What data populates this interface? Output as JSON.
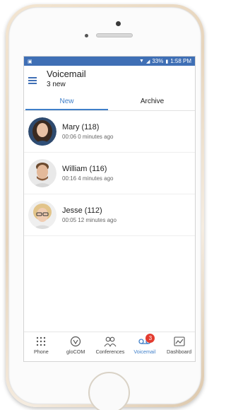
{
  "status_bar": {
    "battery": "33%",
    "time": "1:58 PM"
  },
  "header": {
    "title": "Voicemail",
    "subtitle": "3 new"
  },
  "tabs": [
    {
      "label": "New",
      "active": true
    },
    {
      "label": "Archive",
      "active": false
    }
  ],
  "voicemails": [
    {
      "name": "Mary (118)",
      "meta": "00:06 0 minutes ago"
    },
    {
      "name": "William (116)",
      "meta": "00:16 4 minutes ago"
    },
    {
      "name": "Jesse (112)",
      "meta": "00:05 12 minutes ago"
    }
  ],
  "bottom_nav": [
    {
      "label": "Phone",
      "icon": "dialpad-icon"
    },
    {
      "label": "gloCOM",
      "icon": "chat-icon"
    },
    {
      "label": "Conferences",
      "icon": "conference-icon"
    },
    {
      "label": "Voicemail",
      "icon": "voicemail-icon",
      "badge": "3",
      "active": true
    },
    {
      "label": "Dashboard",
      "icon": "dashboard-icon"
    }
  ],
  "colors": {
    "accent": "#3f7fc9",
    "status_bar": "#3f6fb5",
    "badge": "#e33b2f"
  }
}
